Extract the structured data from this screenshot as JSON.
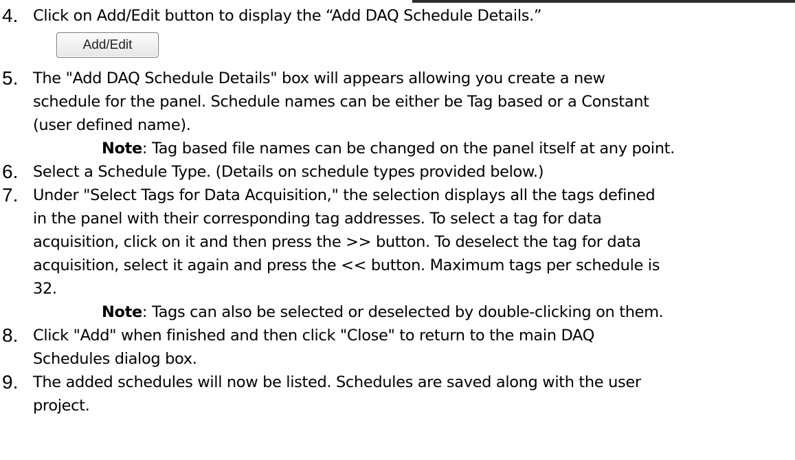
{
  "steps": [
    {
      "num": "4.",
      "lines": [
        "Click on Add/Edit button to display the “Add DAQ Schedule Details.”"
      ]
    },
    {
      "num": "5.",
      "lines": [
        "The \"Add DAQ Schedule Details\" box will appears allowing you create a new",
        "schedule for the panel.  Schedule names can be either be Tag based or a Constant",
        "(user defined name)."
      ],
      "note_label": "Note",
      "note_text": ": Tag based file names can be changed on the panel itself at any point."
    },
    {
      "num": "6.",
      "lines": [
        "Select a Schedule Type. (Details on schedule types provided below.)"
      ]
    },
    {
      "num": "7.",
      "lines": [
        "Under \"Select Tags for Data Acquisition,\" the selection displays all the tags defined",
        "in the panel with their corresponding tag addresses. To select a tag for data",
        "acquisition, click on it and then press the >> button.  To deselect the tag for data",
        "acquisition, select it again and press the << button. Maximum tags per schedule is",
        "32."
      ],
      "note_label": "Note",
      "note_text": ": Tags can also be selected or deselected by double-clicking on them."
    },
    {
      "num": "8.",
      "lines": [
        "Click \"Add\" when finished and then click \"Close\" to return to the main DAQ",
        "Schedules dialog box."
      ]
    },
    {
      "num": "9.",
      "lines": [
        "The added schedules will now be listed.  Schedules are saved along with the user",
        "project."
      ]
    }
  ],
  "button": {
    "label": "Add/Edit"
  }
}
